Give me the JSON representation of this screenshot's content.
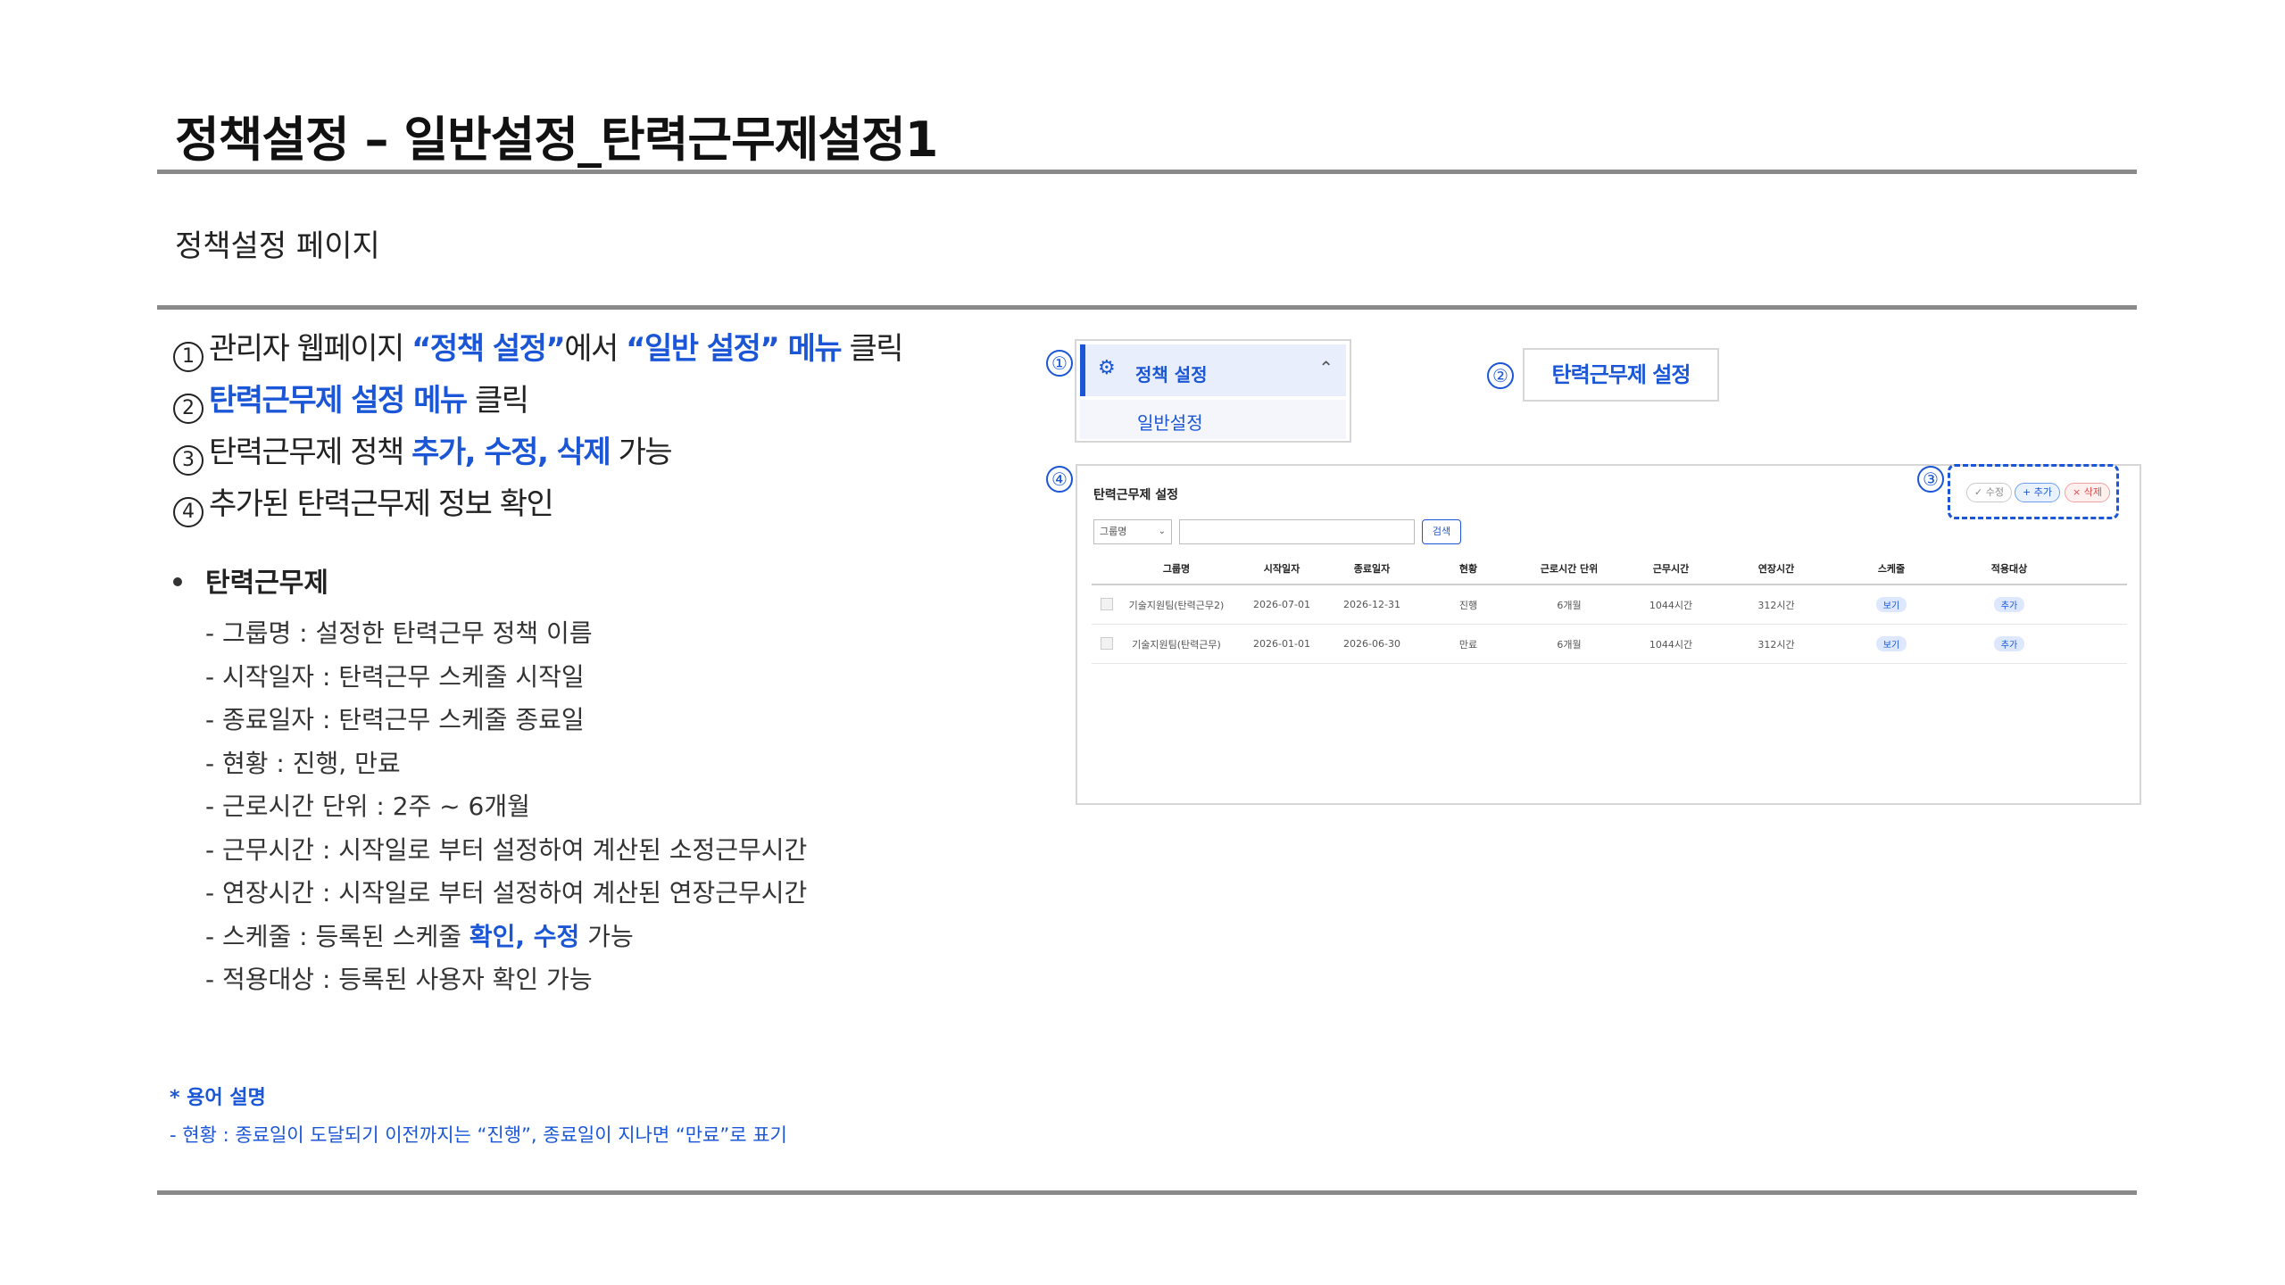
{
  "title": "정책설정 – 일반설정_탄력근무제설정1",
  "subtitle": "정책설정 페이지",
  "steps": [
    {
      "num": "1",
      "parts": [
        {
          "text": "관리자 웹페이지 ",
          "hl": false
        },
        {
          "text": "“정책 설정”",
          "hl": true
        },
        {
          "text": "에서 ",
          "hl": false
        },
        {
          "text": "“일반 설정” 메뉴",
          "hl": true
        },
        {
          "text": " 클릭",
          "hl": false
        }
      ]
    },
    {
      "num": "2",
      "parts": [
        {
          "text": "탄력근무제 설정 메뉴",
          "hl": true
        },
        {
          "text": " 클릭",
          "hl": false
        }
      ]
    },
    {
      "num": "3",
      "parts": [
        {
          "text": "탄력근무제 정책 ",
          "hl": false
        },
        {
          "text": "추가, 수정, 삭제",
          "hl": true
        },
        {
          "text": " 가능",
          "hl": false
        }
      ]
    },
    {
      "num": "4",
      "parts": [
        {
          "text": "추가된 탄력근무제 정보 확인",
          "hl": false
        }
      ]
    }
  ],
  "definitions": {
    "heading": "탄력근무제",
    "items": [
      [
        {
          "text": " - 그룹명 : 설정한 탄력근무 정책 이름",
          "hl": false
        }
      ],
      [
        {
          "text": "- 시작일자 : 탄력근무 스케줄 시작일",
          "hl": false
        }
      ],
      [
        {
          "text": "- 종료일자 : 탄력근무 스케줄 종료일",
          "hl": false
        }
      ],
      [
        {
          "text": "- 현황 : 진행, 만료",
          "hl": false
        }
      ],
      [
        {
          "text": "- 근로시간 단위 : 2주 ~ 6개월",
          "hl": false
        }
      ],
      [
        {
          "text": "- 근무시간 : 시작일로 부터 설정하여 계산된 소정근무시간",
          "hl": false
        }
      ],
      [
        {
          "text": "- 연장시간 : 시작일로 부터 설정하여 계산된 연장근무시간",
          "hl": false
        }
      ],
      [
        {
          "text": "- 스케줄 : 등록된 스케줄 ",
          "hl": false
        },
        {
          "text": "확인, 수정",
          "hl": true
        },
        {
          "text": " 가능",
          "hl": false
        }
      ],
      [
        {
          "text": "- 적용대상 : 등록된 사용자 확인 가능",
          "hl": false
        }
      ]
    ]
  },
  "terms": {
    "heading": "* 용어 설명",
    "text": "- 현황 : 종료일이 도달되기 이전까지는 “진행”, 종료일이 지나면 “만료”로 표기"
  },
  "callouts": {
    "c1": "①",
    "c2": "②",
    "c3": "③",
    "c4": "④"
  },
  "menu": {
    "gear_icon": "gear-icon",
    "main_label": "정책 설정",
    "sub_label": "일반설정"
  },
  "flex_button": "탄력근무제 설정",
  "panel": {
    "title": "탄력근무제 설정",
    "select_value": "그룹명",
    "search_button": "검색",
    "actions": {
      "edit": "수정",
      "add": "추가",
      "delete": "삭제"
    },
    "columns": [
      "그룹명",
      "시작일자",
      "종료일자",
      "현황",
      "근로시간 단위",
      "근무시간",
      "연장시간",
      "스케줄",
      "적용대상"
    ],
    "rows": [
      [
        "기술지원팀(탄력근무2)",
        "2026-07-01",
        "2026-12-31",
        "진행",
        "6개월",
        "1044시간",
        "312시간",
        "보기",
        "추가"
      ],
      [
        "기술지원팀(탄력근무)",
        "2026-01-01",
        "2026-06-30",
        "만료",
        "6개월",
        "1044시간",
        "312시간",
        "보기",
        "추가"
      ]
    ]
  },
  "colors": {
    "accent": "#1a56d6",
    "rule": "#8a8a8a",
    "delete": "#e04848"
  }
}
